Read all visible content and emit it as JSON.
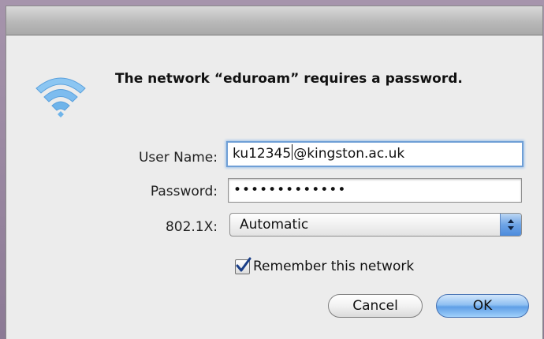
{
  "dialog": {
    "headline": "The network “eduroam” requires a password.",
    "icon": "wifi-icon"
  },
  "form": {
    "username_label": "User Name:",
    "username_before_caret": "ku12345",
    "username_after_caret": "@kingston.ac.uk",
    "password_label": "Password:",
    "password_masked": "•••••••••••••",
    "auth_label": "802.1X:",
    "auth_selected": "Automatic",
    "remember_label": "Remember this network",
    "remember_checked": true
  },
  "buttons": {
    "cancel_label": "Cancel",
    "ok_label": "OK"
  },
  "colors": {
    "accent": "#5f9fe6",
    "wifi": "#6fb4ea",
    "checkmark": "#1b3f88"
  }
}
